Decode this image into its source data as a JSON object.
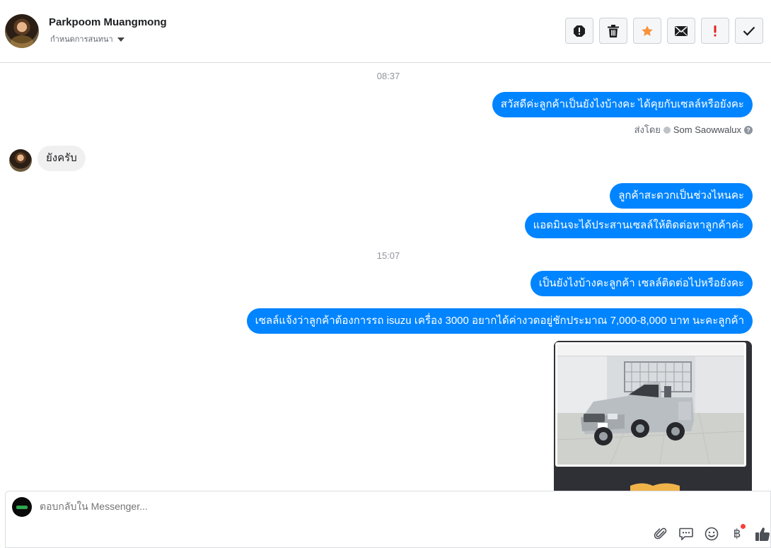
{
  "header": {
    "contact_name": "Parkpoom Muangmong",
    "conversation_menu_label": "กำหนดการสนทนา"
  },
  "toolbar": {
    "buttons": [
      "mark-spam",
      "delete",
      "star",
      "mark-unread",
      "important",
      "done"
    ]
  },
  "conversation": {
    "timestamp_1": "08:37",
    "msg_out_1": "สวัสดีค่ะลูกค้าเป็นยังไงบ้างคะ ได้คุยกับเซลล์หรือยังคะ",
    "sent_by_label": "ส่งโดย",
    "sent_by_name": "Som Saowwalux",
    "msg_in_1": "ยังครับ",
    "msg_out_2": "ลูกค้าสะดวกเป็นช่วงไหนคะ",
    "msg_out_3": "แอดมินจะได้ประสานเซลล์ให้ติดต่อหาลูกค้าค่ะ",
    "timestamp_2": "15:07",
    "msg_out_4": "เป็นยังไงบ้างคะลูกค้า เซลล์ติดต่อไปหรือยังคะ",
    "msg_out_5": "เซลล์แจ้งว่าลูกค้าต้องการรถ isuzu เครื่อง 3000 อยากได้ค่างวดอยู่ชักประมาณ 7,000-8,000 บาท นะคะลูกค้า"
  },
  "composer": {
    "placeholder": "ตอบกลับใน Messenger...",
    "icons": [
      "attachment-icon",
      "saved-reply-icon",
      "emoji-icon",
      "payment-icon",
      "like-icon"
    ]
  },
  "colors": {
    "outgoing_bubble": "#0084ff",
    "incoming_bubble": "#f1f0f0",
    "star": "#f7923b",
    "important": "#e02424"
  }
}
